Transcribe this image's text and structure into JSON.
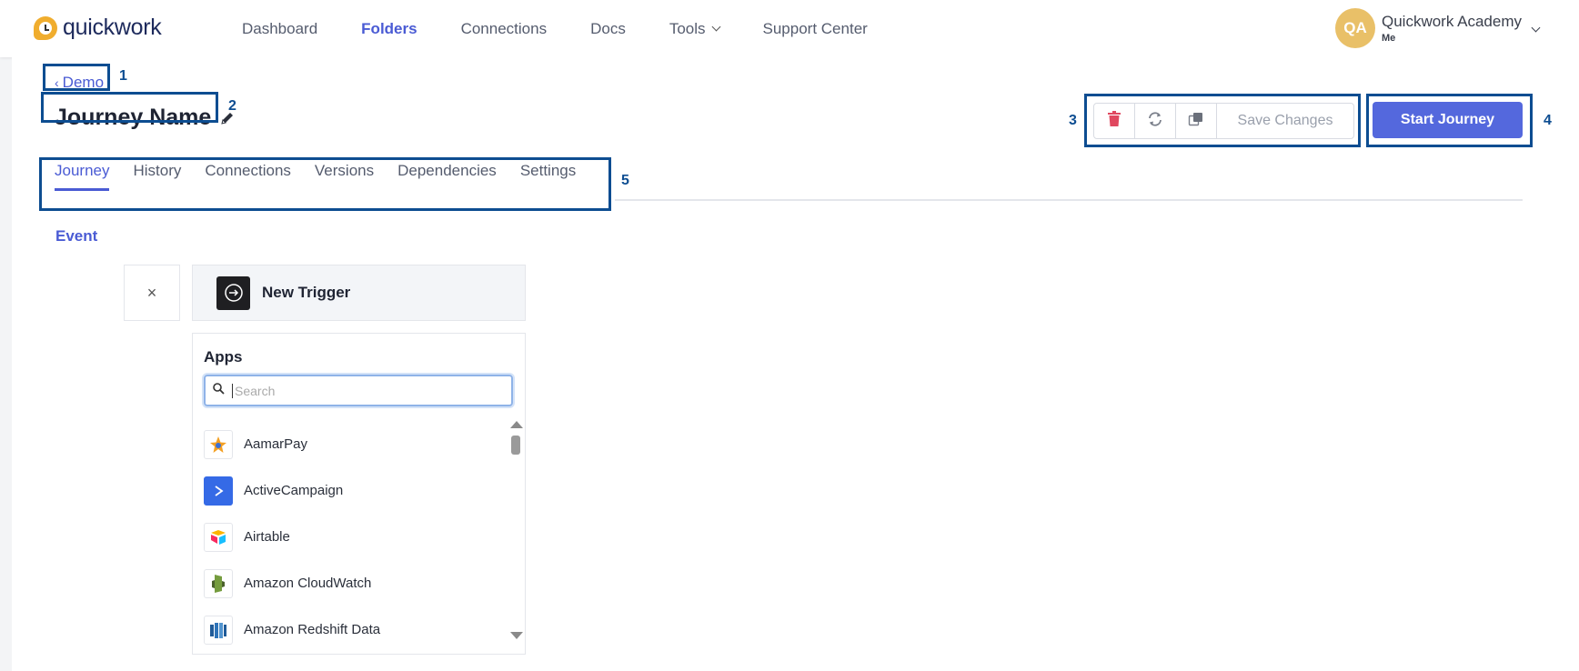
{
  "header": {
    "logo_text": "quickwork",
    "nav": [
      {
        "label": "Dashboard",
        "active": false
      },
      {
        "label": "Folders",
        "active": true
      },
      {
        "label": "Connections",
        "active": false
      },
      {
        "label": "Docs",
        "active": false
      },
      {
        "label": "Tools",
        "active": false
      },
      {
        "label": "Support Center",
        "active": false
      }
    ],
    "user": {
      "initials": "QA",
      "name": "Quickwork Academy",
      "sub": "Me"
    }
  },
  "breadcrumb": {
    "back_label": "Demo"
  },
  "journey": {
    "name": "Journey Name"
  },
  "toolbar": {
    "delete_icon": "trash-icon",
    "refresh_icon": "refresh-icon",
    "copy_icon": "copy-icon",
    "save_label": "Save Changes",
    "start_label": "Start Journey"
  },
  "tabs": [
    {
      "label": "Journey",
      "active": true
    },
    {
      "label": "History",
      "active": false
    },
    {
      "label": "Connections",
      "active": false
    },
    {
      "label": "Versions",
      "active": false
    },
    {
      "label": "Dependencies",
      "active": false
    },
    {
      "label": "Settings",
      "active": false
    }
  ],
  "annotations": [
    "1",
    "2",
    "3",
    "4",
    "5"
  ],
  "event": {
    "section_label": "Event",
    "close_symbol": "×",
    "trigger_label": "New Trigger"
  },
  "apps": {
    "title": "Apps",
    "search_placeholder": "Search",
    "items": [
      {
        "name": "AamarPay",
        "icon": "aamarpay-icon"
      },
      {
        "name": "ActiveCampaign",
        "icon": "activecampaign-icon"
      },
      {
        "name": "Airtable",
        "icon": "airtable-icon"
      },
      {
        "name": "Amazon CloudWatch",
        "icon": "amazon-cloudwatch-icon"
      },
      {
        "name": "Amazon Redshift Data",
        "icon": "amazon-redshift-icon"
      }
    ]
  },
  "colors": {
    "accent": "#4a5bd4",
    "primary_button": "#5468dd",
    "annotation": "#0d4d91",
    "avatar": "#e9c068",
    "delete_icon": "#e0485f"
  }
}
